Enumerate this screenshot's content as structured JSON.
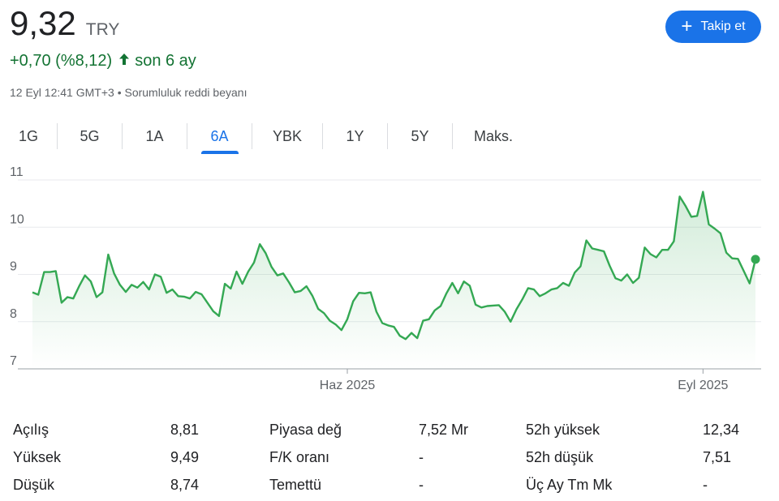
{
  "quote": {
    "price": "9,32",
    "currency": "TRY",
    "change": "+0,70 (%8,12)",
    "change_period": "son 6 ay",
    "timestamp": "12 Eyl 12:41 GMT+3",
    "separator": "•",
    "disclaimer": "Sorumluluk reddi beyanı"
  },
  "follow_button": {
    "label": "Takip et",
    "icon": "plus-icon"
  },
  "tabs": [
    "1G",
    "5G",
    "1A",
    "6A",
    "YBK",
    "1Y",
    "5Y",
    "Maks."
  ],
  "selected_tab": "6A",
  "colors": {
    "accent": "#1a73e8",
    "positive": "#137333",
    "line": "#34a853"
  },
  "chart_data": {
    "type": "area",
    "ylim": [
      7,
      11
    ],
    "yticks": [
      "7",
      "8",
      "9",
      "10",
      "11"
    ],
    "x_labels": [
      {
        "label": "Haz 2025",
        "index": 54
      },
      {
        "label": "Eyl 2025",
        "index": 115
      }
    ],
    "grid": true,
    "values": [
      8.62,
      8.57,
      9.05,
      9.05,
      9.07,
      8.4,
      8.52,
      8.49,
      8.75,
      8.98,
      8.85,
      8.52,
      8.62,
      9.42,
      9.02,
      8.78,
      8.63,
      8.78,
      8.72,
      8.84,
      8.68,
      9.0,
      8.95,
      8.61,
      8.68,
      8.54,
      8.53,
      8.49,
      8.63,
      8.58,
      8.4,
      8.22,
      8.12,
      8.8,
      8.7,
      9.06,
      8.8,
      9.06,
      9.25,
      9.64,
      9.45,
      9.16,
      8.98,
      9.02,
      8.83,
      8.62,
      8.65,
      8.75,
      8.55,
      8.27,
      8.18,
      8.02,
      7.94,
      7.82,
      8.05,
      8.43,
      8.61,
      8.6,
      8.62,
      8.21,
      7.97,
      7.92,
      7.89,
      7.7,
      7.63,
      7.76,
      7.65,
      8.02,
      8.05,
      8.24,
      8.33,
      8.6,
      8.82,
      8.6,
      8.85,
      8.76,
      8.36,
      8.3,
      8.33,
      8.34,
      8.35,
      8.21,
      8.0,
      8.26,
      8.47,
      8.71,
      8.68,
      8.54,
      8.6,
      8.68,
      8.71,
      8.82,
      8.76,
      9.04,
      9.17,
      9.72,
      9.55,
      9.52,
      9.49,
      9.18,
      8.92,
      8.87,
      9.0,
      8.82,
      8.93,
      9.57,
      9.43,
      9.36,
      9.52,
      9.52,
      9.7,
      10.65,
      10.45,
      10.22,
      10.24,
      10.75,
      10.06,
      9.97,
      9.87,
      9.46,
      9.34,
      9.33,
      9.07,
      8.81,
      9.32
    ]
  },
  "stats": [
    [
      {
        "label": "Açılış",
        "value": "8,81"
      },
      {
        "label": "Piyasa değ",
        "value": "7,52 Mr"
      },
      {
        "label": "52h yüksek",
        "value": "12,34"
      }
    ],
    [
      {
        "label": "Yüksek",
        "value": "9,49"
      },
      {
        "label": "F/K oranı",
        "value": "-"
      },
      {
        "label": "52h düşük",
        "value": "7,51"
      }
    ],
    [
      {
        "label": "Düşük",
        "value": "8,74"
      },
      {
        "label": "Temettü",
        "value": "-"
      },
      {
        "label": "Üç Ay Tm Mk",
        "value": "-"
      }
    ]
  ]
}
